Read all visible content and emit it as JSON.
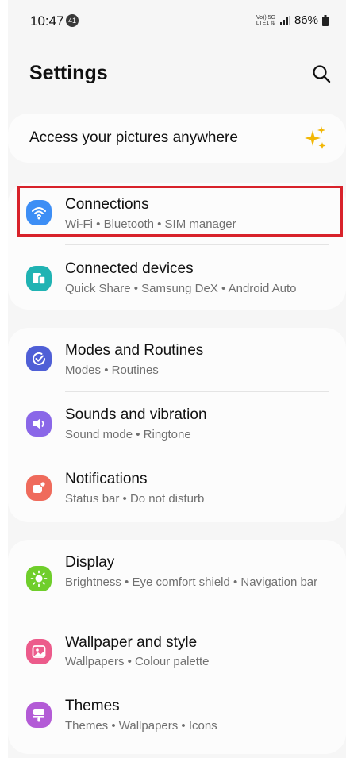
{
  "status_bar": {
    "time": "10:47",
    "notification_count": "41",
    "network_top": "Vo)) 5G",
    "network_bottom": "LTE1 ⇅",
    "battery": "86%"
  },
  "header": {
    "title": "Settings",
    "search_icon": "search-icon"
  },
  "promo": {
    "text": "Access your pictures anywhere",
    "icon": "sparkle-icon",
    "icon_color": "#f2b705"
  },
  "sections": [
    {
      "items": [
        {
          "title": "Connections",
          "subtitle": "Wi-Fi  •  Bluetooth  •  SIM manager",
          "icon": "wifi-icon",
          "color": "#3d8ef5",
          "highlighted": true,
          "highlight_color": "#d8222a"
        },
        {
          "title": "Connected devices",
          "subtitle": "Quick Share  •  Samsung DeX  •  Android Auto",
          "icon": "connected-devices-icon",
          "color": "#20b3b3"
        }
      ]
    },
    {
      "items": [
        {
          "title": "Modes and Routines",
          "subtitle": "Modes  •  Routines",
          "icon": "check-circle-icon",
          "color": "#4f5fd6"
        },
        {
          "title": "Sounds and vibration",
          "subtitle": "Sound mode  •  Ringtone",
          "icon": "speaker-icon",
          "color": "#8a67e8"
        },
        {
          "title": "Notifications",
          "subtitle": "Status bar  •  Do not disturb",
          "icon": "bell-icon",
          "color": "#ef6b5c"
        }
      ]
    },
    {
      "items": [
        {
          "title": "Display",
          "subtitle": "Brightness  •  Eye comfort shield  •  Navigation bar",
          "icon": "sun-icon",
          "color": "#6fce2b"
        },
        {
          "title": "Wallpaper and style",
          "subtitle": "Wallpapers  •  Colour palette",
          "icon": "image-icon",
          "color": "#ec5b8b"
        },
        {
          "title": "Themes",
          "subtitle": "Themes  •  Wallpapers  •  Icons",
          "icon": "theme-brush-icon",
          "color": "#b35bd6"
        }
      ]
    }
  ]
}
